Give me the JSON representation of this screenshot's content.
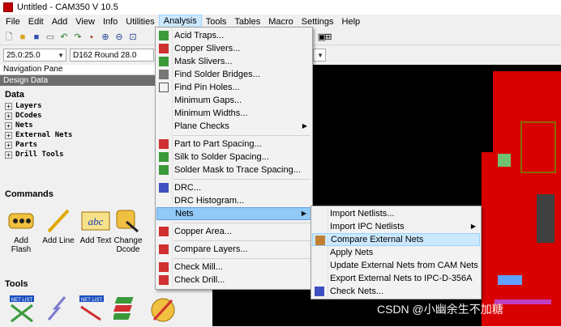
{
  "window": {
    "title": "Untitled - CAM350 V 10.5"
  },
  "menubar": [
    "File",
    "Edit",
    "Add",
    "View",
    "Info",
    "Utilities",
    "Analysis",
    "Tools",
    "Tables",
    "Macro",
    "Settings",
    "Help"
  ],
  "toolbar2": {
    "coord": "25.0:25.0",
    "dcode": "D162  Round 28.0"
  },
  "navigation": {
    "pane_title": "Navigation Pane",
    "design_data_title": "Design Data",
    "data_title": "Data",
    "tree": [
      "Layers",
      "DCodes",
      "Nets",
      "External Nets",
      "Parts",
      "Drill Tools"
    ],
    "commands_title": "Commands",
    "commands": [
      {
        "label": "Add Flash",
        "icon": "flash-icon"
      },
      {
        "label": "Add Line",
        "icon": "line-icon"
      },
      {
        "label": "Add Text",
        "icon": "text-icon",
        "icon_text": "abc"
      },
      {
        "label": "Change Dcode",
        "icon": "change-dcode-icon"
      }
    ],
    "tools_title": "Tools",
    "tool_icon_text": "NET LIST"
  },
  "analysis_menu": [
    {
      "label": "Acid Traps...",
      "icon": "acid-traps-icon"
    },
    {
      "label": "Copper Slivers...",
      "icon": "copper-slivers-icon"
    },
    {
      "label": "Mask Slivers...",
      "icon": "mask-slivers-icon"
    },
    {
      "label": "Find Solder Bridges...",
      "icon": "solder-bridges-icon"
    },
    {
      "label": "Find Pin Holes...",
      "icon": "pin-holes-icon"
    },
    {
      "label": "Minimum Gaps...",
      "icon": ""
    },
    {
      "label": "Minimum Widths...",
      "icon": ""
    },
    {
      "label": "Plane Checks",
      "icon": "",
      "submenu": true
    },
    {
      "label": "Part to Part Spacing...",
      "icon": "part-spacing-icon"
    },
    {
      "label": "Silk to Solder Spacing...",
      "icon": "silk-spacing-icon"
    },
    {
      "label": "Solder Mask to Trace Spacing...",
      "icon": "mask-trace-icon"
    },
    {
      "label": "DRC...",
      "icon": "drc-icon"
    },
    {
      "label": "DRC Histogram...",
      "icon": ""
    },
    {
      "label": "Nets",
      "icon": "",
      "submenu": true
    },
    {
      "label": "Copper Area...",
      "icon": "copper-area-icon"
    },
    {
      "label": "Compare Layers...",
      "icon": "compare-layers-icon"
    },
    {
      "label": "Check Mill...",
      "icon": "check-mill-icon"
    },
    {
      "label": "Check Drill...",
      "icon": "check-drill-icon"
    }
  ],
  "nets_submenu": [
    {
      "label": "Import Netlists...",
      "icon": ""
    },
    {
      "label": "Import IPC Netlists",
      "icon": "",
      "submenu": true
    },
    {
      "label": "Compare External Nets",
      "icon": "compare-nets-icon"
    },
    {
      "label": "Apply Nets",
      "icon": ""
    },
    {
      "label": "Update External Nets from CAM Nets",
      "icon": ""
    },
    {
      "label": "Export External Nets to IPC-D-356A",
      "icon": ""
    },
    {
      "label": "Check Nets...",
      "icon": "check-nets-icon"
    }
  ],
  "watermark": "CSDN @小幽余生不加糖",
  "colors": {
    "pcb_red": "#e00000",
    "canvas": "#000000",
    "menu_highlight": "#91c9f7",
    "hover": "#cce8ff"
  }
}
